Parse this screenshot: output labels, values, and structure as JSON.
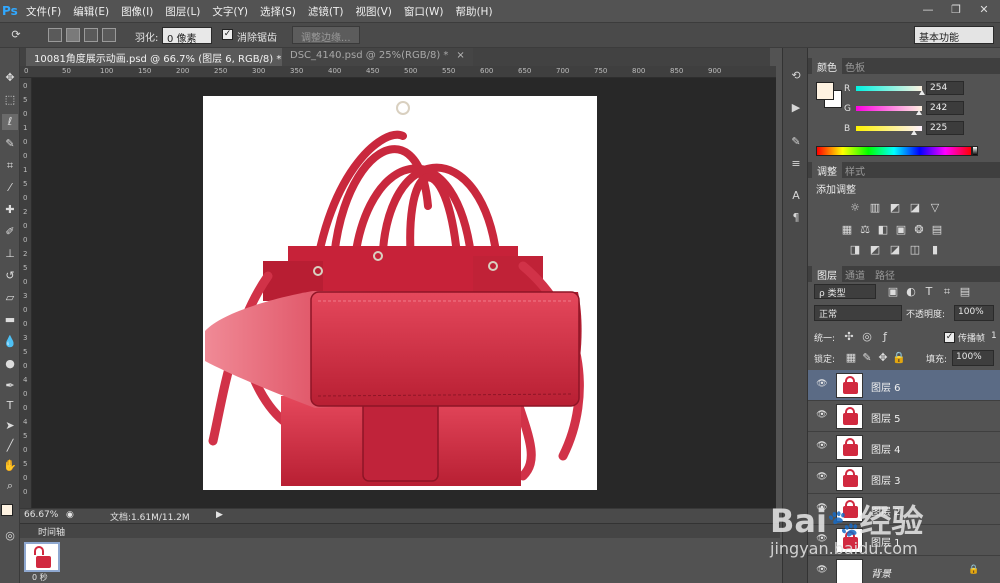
{
  "app": {
    "logo": "Ps"
  },
  "menu": [
    "文件(F)",
    "编辑(E)",
    "图像(I)",
    "图层(L)",
    "文字(Y)",
    "选择(S)",
    "滤镜(T)",
    "视图(V)",
    "窗口(W)",
    "帮助(H)"
  ],
  "window_controls": {
    "minimize": "—",
    "restore": "❐",
    "close": "✕"
  },
  "options": {
    "feather_label": "羽化:",
    "feather_value": "0 像素",
    "antialias_label": "消除锯齿",
    "antialias_checked": "✓",
    "refine_edge": "调整边缘...",
    "workspace": "基本功能"
  },
  "tabs": [
    {
      "label": "10081角度展示动画.psd @ 66.7% (图层 6, RGB/8) *",
      "close": "×"
    },
    {
      "label": "DSC_4140.psd @ 25%(RGB/8) *",
      "close": "×"
    }
  ],
  "ruler_top": [
    "0",
    "50",
    "100",
    "150",
    "200",
    "250",
    "300",
    "350",
    "400",
    "450",
    "500",
    "550",
    "600",
    "650",
    "700",
    "750",
    "800",
    "850",
    "900"
  ],
  "ruler_left": [
    "0",
    "5",
    "0",
    "1",
    "0",
    "0",
    "1",
    "5",
    "0",
    "2",
    "0",
    "0",
    "2",
    "5",
    "0",
    "3",
    "0",
    "0",
    "3",
    "5",
    "0",
    "4",
    "0",
    "0",
    "4",
    "5",
    "0",
    "5",
    "0",
    "0"
  ],
  "status": {
    "zoom": "66.67%",
    "doc_size": "文档:1.61M/11.2M"
  },
  "timeline": {
    "label": "时间轴",
    "frame_time": "0 秒"
  },
  "color_panel": {
    "tabs": [
      "颜色",
      "色板"
    ],
    "r_label": "R",
    "g_label": "G",
    "b_label": "B",
    "r": "254",
    "g": "242",
    "b": "225",
    "r_fraction": 0.996,
    "g_fraction": 0.949,
    "b_fraction": 0.882,
    "foreground": "#fef2e1"
  },
  "adjust_panel": {
    "tabs": [
      "调整",
      "样式"
    ],
    "heading": "添加调整"
  },
  "layers_panel": {
    "tabs": [
      "图层",
      "通道",
      "路径"
    ],
    "filter": "ρ 类型",
    "blend_mode": "正常",
    "opacity_label": "不透明度:",
    "opacity": "100%",
    "unify_label": "统一:",
    "propagate_label": "传播帧",
    "propagate_value": "1",
    "lock_label": "锁定:",
    "fill_label": "填充:",
    "fill": "100%",
    "layers": [
      {
        "name": "图层 6",
        "selected": true
      },
      {
        "name": "图层 5",
        "selected": false
      },
      {
        "name": "图层 4",
        "selected": false
      },
      {
        "name": "图层 3",
        "selected": false
      },
      {
        "name": "图层 2",
        "selected": false
      },
      {
        "name": "图层 1",
        "selected": false
      },
      {
        "name": "背景",
        "selected": false
      }
    ]
  },
  "watermark": {
    "brand": "Bai",
    "brand2": "经验",
    "url": "jingyan.baidu.com"
  },
  "colors": {
    "accent": "#31a8ff",
    "bag_red": "#d1293f",
    "selected_layer": "#5b6b85"
  }
}
